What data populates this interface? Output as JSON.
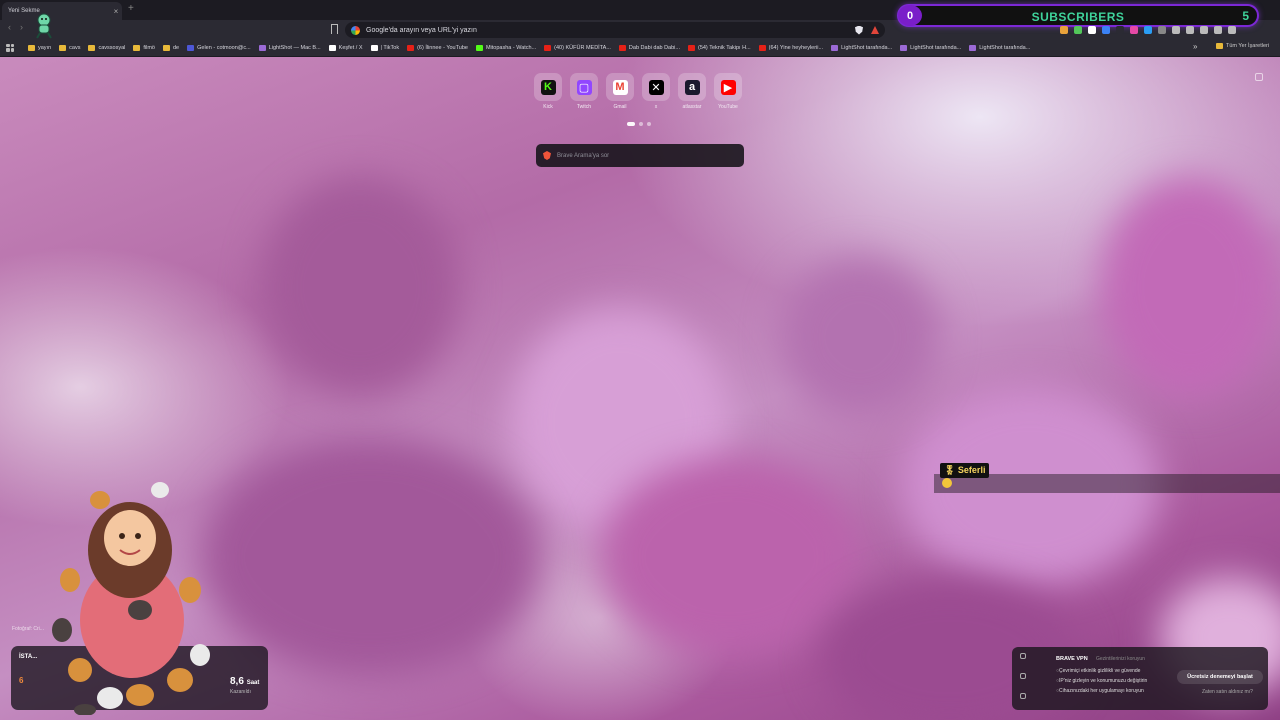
{
  "tab": {
    "title": "Yeni Sekme",
    "close": "×",
    "new": "+"
  },
  "address": {
    "placeholder": "Google'da arayın veya URL'yi yazın"
  },
  "subscribers": {
    "left_count": "0",
    "label": "SUBSCRIBERS",
    "right_count": "5"
  },
  "bookmarks": [
    {
      "label": "yayın",
      "icon": "folder-icon",
      "color": "#e8b93a"
    },
    {
      "label": "cavs",
      "icon": "folder-icon",
      "color": "#e8b93a"
    },
    {
      "label": "cavssosyal",
      "icon": "folder-icon",
      "color": "#e8b93a"
    },
    {
      "label": "filmö",
      "icon": "folder-icon",
      "color": "#e8b93a"
    },
    {
      "label": "de",
      "icon": "folder-icon",
      "color": "#e8b93a"
    },
    {
      "label": "Gelen - cotmoon@c...",
      "icon": "mail-icon",
      "color": "#4d57d6"
    },
    {
      "label": "LightShot — Mac B...",
      "icon": "feather-icon",
      "color": "#9b6ad6"
    },
    {
      "label": "Keşfet / X",
      "icon": "x-icon",
      "color": "#ffffff"
    },
    {
      "label": "| TikTok",
      "icon": "tiktok-icon",
      "color": "#ffffff"
    },
    {
      "label": "(6) İlinnee - YouTube",
      "icon": "youtube-icon",
      "color": "#e62117"
    },
    {
      "label": "Mitopasha - Watch...",
      "icon": "kick-icon",
      "color": "#53fc18"
    },
    {
      "label": "(40) KÜFÜR MEDİTA...",
      "icon": "youtube-icon",
      "color": "#e62117"
    },
    {
      "label": "Dab Dabi dab Dabi...",
      "icon": "youtube-icon",
      "color": "#e62117"
    },
    {
      "label": "(54) Teknik Takipı H...",
      "icon": "youtube-icon",
      "color": "#e62117"
    },
    {
      "label": "(64) Yine heyheylerii...",
      "icon": "youtube-icon",
      "color": "#e62117"
    },
    {
      "label": "LightShot tarafında...",
      "icon": "feather-icon",
      "color": "#9b6ad6"
    },
    {
      "label": "LightShot tarafında...",
      "icon": "feather-icon",
      "color": "#9b6ad6"
    },
    {
      "label": "LightShot tarafında...",
      "icon": "feather-icon",
      "color": "#9b6ad6"
    }
  ],
  "bookmarks_more": "»",
  "bookmarks_all": "Tüm Yer İşaretleri",
  "tiles": [
    {
      "label": "Kick",
      "icon": "kick-icon",
      "glyph": "K",
      "bg": "#111111",
      "fg": "#53fc18"
    },
    {
      "label": "Twitch",
      "icon": "twitch-icon",
      "glyph": "▢",
      "bg": "#9146ff",
      "fg": "#ffffff"
    },
    {
      "label": "Gmail",
      "icon": "gmail-icon",
      "glyph": "M",
      "bg": "#ffffff",
      "fg": "#ea4335"
    },
    {
      "label": "x",
      "icon": "x-icon",
      "glyph": "✕",
      "bg": "#000000",
      "fg": "#ffffff"
    },
    {
      "label": "atlasstar",
      "icon": "atlas-icon",
      "glyph": "a",
      "bg": "#1a1a2e",
      "fg": "#ffffff"
    },
    {
      "label": "YouTube",
      "icon": "youtube-icon",
      "glyph": "▶",
      "bg": "#ff0000",
      "fg": "#ffffff"
    }
  ],
  "search": {
    "placeholder": "Brave Arama'ya sor"
  },
  "chat": {
    "username": "🎖 Seferli"
  },
  "photo_credit": "Fotoğraf: Cri...",
  "weather": {
    "city": "İSTA...",
    "temp": "6",
    "hours": "8,6",
    "hours_unit": "Saat",
    "hours_sub": "Kazanıldı"
  },
  "vpn": {
    "title": "BRAVE VPN",
    "subtitle": "Gezintilerinizi koruyun",
    "features": [
      "Çevrimiçi etkinlik gizlilikli ve güvende",
      "IP'niz gizleyin ve konumunuzu değiştirin",
      "Cihazınızdaki her uygulamayı koruyun"
    ],
    "cta": "Ücretsiz denemeyi başlat",
    "link": "Zaten satın aldınız mı?"
  },
  "colors": {
    "accent": "#7c28d6",
    "subs_text": "#3fd39b",
    "tab_bg": "#2b2a33"
  }
}
